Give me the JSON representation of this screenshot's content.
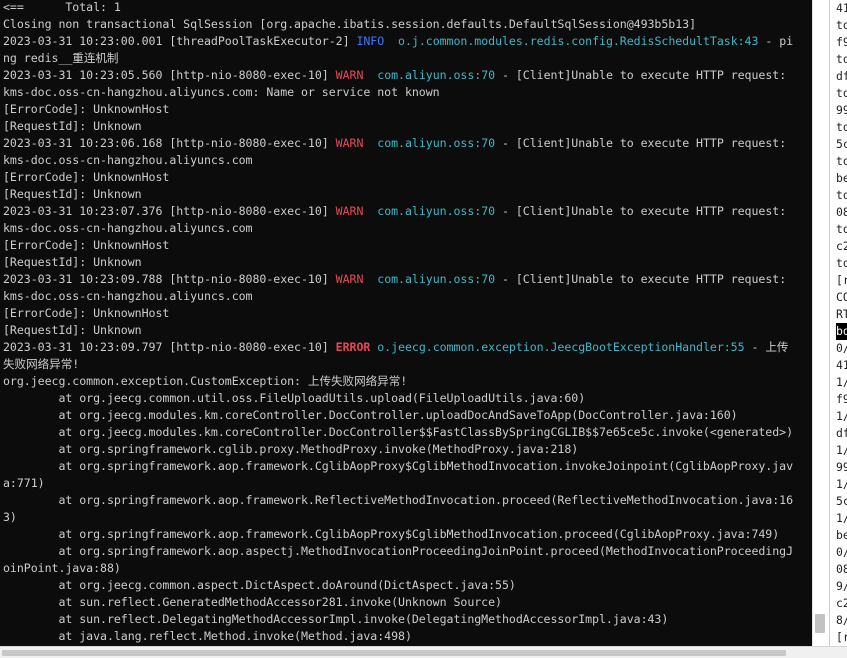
{
  "colors": {
    "terminal_background": "#0c0c0c",
    "default_text": "#cccccc",
    "warn": "#e74856",
    "error": "#e74856",
    "info": "#3b78ff",
    "logger": "#3cb8c8"
  },
  "console": {
    "lines": [
      {
        "segments": [
          {
            "t": "<==      Total: 1"
          }
        ]
      },
      {
        "segments": [
          {
            "t": "Closing non transactional SqlSession [org.apache.ibatis.session.defaults.DefaultSqlSession@493b5b13]"
          }
        ]
      },
      {
        "segments": [
          {
            "t": "2023-03-31 10:23:00.001 [threadPoolTaskExecutor-2] "
          },
          {
            "t": "INFO",
            "c": "info"
          },
          {
            "t": "  "
          },
          {
            "t": "o.j.common.modules.redis.config.RedisSchedultTask:43",
            "c": "cyan"
          },
          {
            "t": " - pi"
          }
        ]
      },
      {
        "segments": [
          {
            "t": "ng redis__重连机制"
          }
        ]
      },
      {
        "segments": [
          {
            "t": "2023-03-31 10:23:05.560 [http-nio-8080-exec-10] "
          },
          {
            "t": "WARN",
            "c": "warn"
          },
          {
            "t": "  "
          },
          {
            "t": "com.aliyun.oss:70",
            "c": "cyan"
          },
          {
            "t": " - [Client]Unable to execute HTTP request:"
          }
        ]
      },
      {
        "segments": [
          {
            "t": "kms-doc.oss-cn-hangzhou.aliyuncs.com: Name or service not known"
          }
        ]
      },
      {
        "segments": [
          {
            "t": "[ErrorCode]: UnknownHost"
          }
        ]
      },
      {
        "segments": [
          {
            "t": "[RequestId]: Unknown"
          }
        ]
      },
      {
        "segments": [
          {
            "t": "2023-03-31 10:23:06.168 [http-nio-8080-exec-10] "
          },
          {
            "t": "WARN",
            "c": "warn"
          },
          {
            "t": "  "
          },
          {
            "t": "com.aliyun.oss:70",
            "c": "cyan"
          },
          {
            "t": " - [Client]Unable to execute HTTP request:"
          }
        ]
      },
      {
        "segments": [
          {
            "t": "kms-doc.oss-cn-hangzhou.aliyuncs.com"
          }
        ]
      },
      {
        "segments": [
          {
            "t": "[ErrorCode]: UnknownHost"
          }
        ]
      },
      {
        "segments": [
          {
            "t": "[RequestId]: Unknown"
          }
        ]
      },
      {
        "segments": [
          {
            "t": "2023-03-31 10:23:07.376 [http-nio-8080-exec-10] "
          },
          {
            "t": "WARN",
            "c": "warn"
          },
          {
            "t": "  "
          },
          {
            "t": "com.aliyun.oss:70",
            "c": "cyan"
          },
          {
            "t": " - [Client]Unable to execute HTTP request:"
          }
        ]
      },
      {
        "segments": [
          {
            "t": "kms-doc.oss-cn-hangzhou.aliyuncs.com"
          }
        ]
      },
      {
        "segments": [
          {
            "t": "[ErrorCode]: UnknownHost"
          }
        ]
      },
      {
        "segments": [
          {
            "t": "[RequestId]: Unknown"
          }
        ]
      },
      {
        "segments": [
          {
            "t": "2023-03-31 10:23:09.788 [http-nio-8080-exec-10] "
          },
          {
            "t": "WARN",
            "c": "warn"
          },
          {
            "t": "  "
          },
          {
            "t": "com.aliyun.oss:70",
            "c": "cyan"
          },
          {
            "t": " - [Client]Unable to execute HTTP request:"
          }
        ]
      },
      {
        "segments": [
          {
            "t": "kms-doc.oss-cn-hangzhou.aliyuncs.com"
          }
        ]
      },
      {
        "segments": [
          {
            "t": "[ErrorCode]: UnknownHost"
          }
        ]
      },
      {
        "segments": [
          {
            "t": "[RequestId]: Unknown"
          }
        ]
      },
      {
        "segments": [
          {
            "t": "2023-03-31 10:23:09.797 [http-nio-8080-exec-10] "
          },
          {
            "t": "ERROR",
            "c": "err"
          },
          {
            "t": " "
          },
          {
            "t": "o.jeecg.common.exception.JeecgBootExceptionHandler:55",
            "c": "cyan"
          },
          {
            "t": " - 上传"
          }
        ]
      },
      {
        "segments": [
          {
            "t": "失败网络异常!"
          }
        ]
      },
      {
        "segments": [
          {
            "t": "org.jeecg.common.exception.CustomException: 上传失败网络异常!"
          }
        ]
      },
      {
        "segments": [
          {
            "t": "\tat org.jeecg.common.util.oss.FileUploadUtils.upload(FileUploadUtils.java:60)"
          }
        ]
      },
      {
        "segments": [
          {
            "t": "\tat org.jeecg.modules.km.coreController.DocController.uploadDocAndSaveToApp(DocController.java:160)"
          }
        ]
      },
      {
        "segments": [
          {
            "t": "\tat org.jeecg.modules.km.coreController.DocController$$FastClassBySpringCGLIB$$7e65ce5c.invoke(<generated>)"
          }
        ]
      },
      {
        "segments": [
          {
            "t": "\tat org.springframework.cglib.proxy.MethodProxy.invoke(MethodProxy.java:218)"
          }
        ]
      },
      {
        "segments": [
          {
            "t": "\tat org.springframework.aop.framework.CglibAopProxy$CglibMethodInvocation.invokeJoinpoint(CglibAopProxy.jav"
          }
        ]
      },
      {
        "segments": [
          {
            "t": "a:771)"
          }
        ]
      },
      {
        "segments": [
          {
            "t": "\tat org.springframework.aop.framework.ReflectiveMethodInvocation.proceed(ReflectiveMethodInvocation.java:16"
          }
        ]
      },
      {
        "segments": [
          {
            "t": "3)"
          }
        ]
      },
      {
        "segments": [
          {
            "t": "\tat org.springframework.aop.framework.CglibAopProxy$CglibMethodInvocation.proceed(CglibAopProxy.java:749)"
          }
        ]
      },
      {
        "segments": [
          {
            "t": "\tat org.springframework.aop.aspectj.MethodInvocationProceedingJoinPoint.proceed(MethodInvocationProceedingJ"
          }
        ]
      },
      {
        "segments": [
          {
            "t": "oinPoint.java:88)"
          }
        ]
      },
      {
        "segments": [
          {
            "t": "\tat org.jeecg.common.aspect.DictAspect.doAround(DictAspect.java:55)"
          }
        ]
      },
      {
        "segments": [
          {
            "t": "\tat sun.reflect.GeneratedMethodAccessor281.invoke(Unknown Source)"
          }
        ]
      },
      {
        "segments": [
          {
            "t": "\tat sun.reflect.DelegatingMethodAccessorImpl.invoke(DelegatingMethodAccessorImpl.java:43)"
          }
        ]
      },
      {
        "segments": [
          {
            "t": "\tat java.lang.reflect.Method.invoke(Method.java:498)"
          }
        ]
      }
    ]
  },
  "side_panel": {
    "lines": [
      "41",
      "to",
      "f9",
      "to",
      "df",
      "to",
      "99",
      "to",
      "5c",
      "to",
      "be",
      "to",
      "08",
      "to",
      "c2",
      "to",
      "[r",
      "CO",
      "RT",
      "bo",
      "0/",
      "41",
      "1/",
      "f9",
      "1/",
      "df",
      "1/",
      "99",
      "1/",
      "5c",
      "1/",
      "be",
      "0/",
      "08",
      "9/",
      "c2",
      "8/",
      "[r"
    ],
    "highlighted_index": 19
  },
  "scroll": {
    "vertical_position": 0.98,
    "vertical_thumb_fraction": 0.03,
    "horizontal_position": 0.0,
    "horizontal_thumb_fraction": 0.93
  }
}
